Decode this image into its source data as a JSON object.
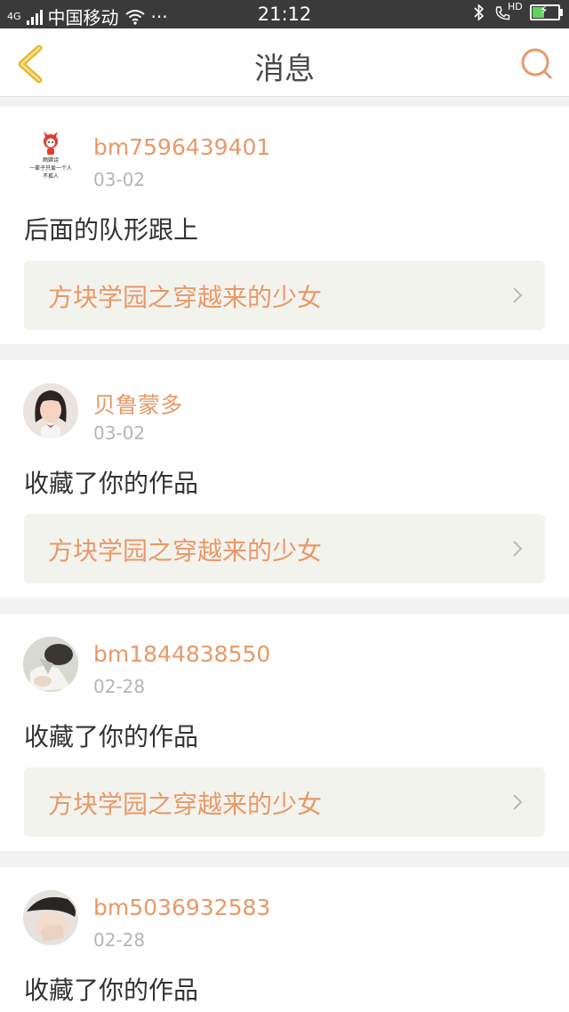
{
  "status_bar": {
    "network": "4G",
    "carrier": "中国移动",
    "dots": "···",
    "time": "21:12",
    "hd": "HD"
  },
  "header": {
    "title": "消息"
  },
  "colors": {
    "accent": "#e89968",
    "back_icon": "#e8b82e",
    "link_bg": "#f3f3ee"
  },
  "messages": [
    {
      "user": "bm7596439401",
      "date": "03-02",
      "text": "后面的队形跟上",
      "work": "方块学园之穿越来的少女",
      "avatar_caption": [
        "雨嫦诗",
        "一辈子只爱一个人",
        "不孤人"
      ]
    },
    {
      "user": "贝鲁蒙多",
      "date": "03-02",
      "text": "收藏了你的作品",
      "work": "方块学园之穿越来的少女"
    },
    {
      "user": "bm1844838550",
      "date": "02-28",
      "text": "收藏了你的作品",
      "work": "方块学园之穿越来的少女"
    },
    {
      "user": "bm5036932583",
      "date": "02-28",
      "text": "收藏了你的作品"
    }
  ]
}
